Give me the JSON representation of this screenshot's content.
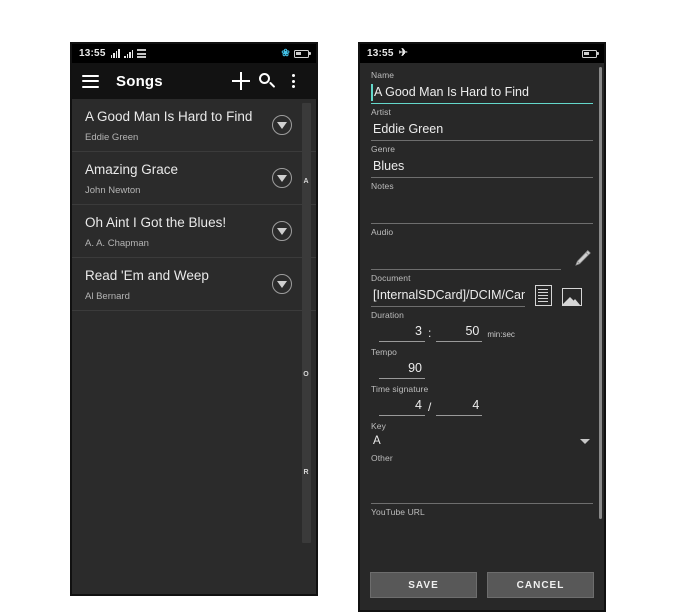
{
  "left_phone": {
    "statusbar": {
      "time": "13:55",
      "icons": [
        "signal-bars-icon",
        "sim-signal-icon",
        "network-grid-icon"
      ],
      "right_icons": [
        "bluetooth-icon",
        "battery-icon"
      ]
    },
    "appbar": {
      "menu_icon": "hamburger-menu-icon",
      "title": "Songs",
      "add_icon": "plus-icon",
      "search_icon": "search-icon",
      "overflow_icon": "kebab-menu-icon"
    },
    "songs": [
      {
        "title": "A Good Man Is Hard to Find",
        "artist": "Eddie Green"
      },
      {
        "title": "Amazing Grace",
        "artist": "John Newton"
      },
      {
        "title": "Oh Aint I Got the Blues!",
        "artist": "A. A. Chapman"
      },
      {
        "title": "Read 'Em and Weep",
        "artist": "Al Bernard"
      }
    ],
    "index_letters": [
      "A",
      "O",
      "R"
    ]
  },
  "right_phone": {
    "statusbar": {
      "time": "13:55",
      "icons": [
        "airplane-mode-icon"
      ],
      "right_icons": [
        "battery-icon"
      ]
    },
    "form": {
      "name": {
        "label": "Name",
        "value": "A Good Man Is Hard to Find",
        "focused": true,
        "accent": "#64d8cb"
      },
      "artist": {
        "label": "Artist",
        "value": "Eddie Green"
      },
      "genre": {
        "label": "Genre",
        "value": "Blues"
      },
      "notes": {
        "label": "Notes",
        "value": ""
      },
      "audio": {
        "label": "Audio",
        "value": "",
        "action_icon": "pencil-icon"
      },
      "document": {
        "label": "Document",
        "value": "[InternalSDCard]/DCIM/Can",
        "doc_icon": "document-icon",
        "image_icon": "image-icon"
      },
      "duration": {
        "label": "Duration",
        "minutes": "3",
        "separator": ":",
        "seconds": "50",
        "unit": "min:sec"
      },
      "tempo": {
        "label": "Tempo",
        "value": "90"
      },
      "time_signature": {
        "label": "Time signature",
        "numerator": "4",
        "separator": "/",
        "denominator": "4"
      },
      "key": {
        "label": "Key",
        "value": "A",
        "dropdown_icon": "chevron-down-icon"
      },
      "other": {
        "label": "Other",
        "value": ""
      },
      "youtube_url": {
        "label": "YouTube URL",
        "value": ""
      }
    },
    "buttons": {
      "save": "SAVE",
      "cancel": "CANCEL"
    }
  }
}
